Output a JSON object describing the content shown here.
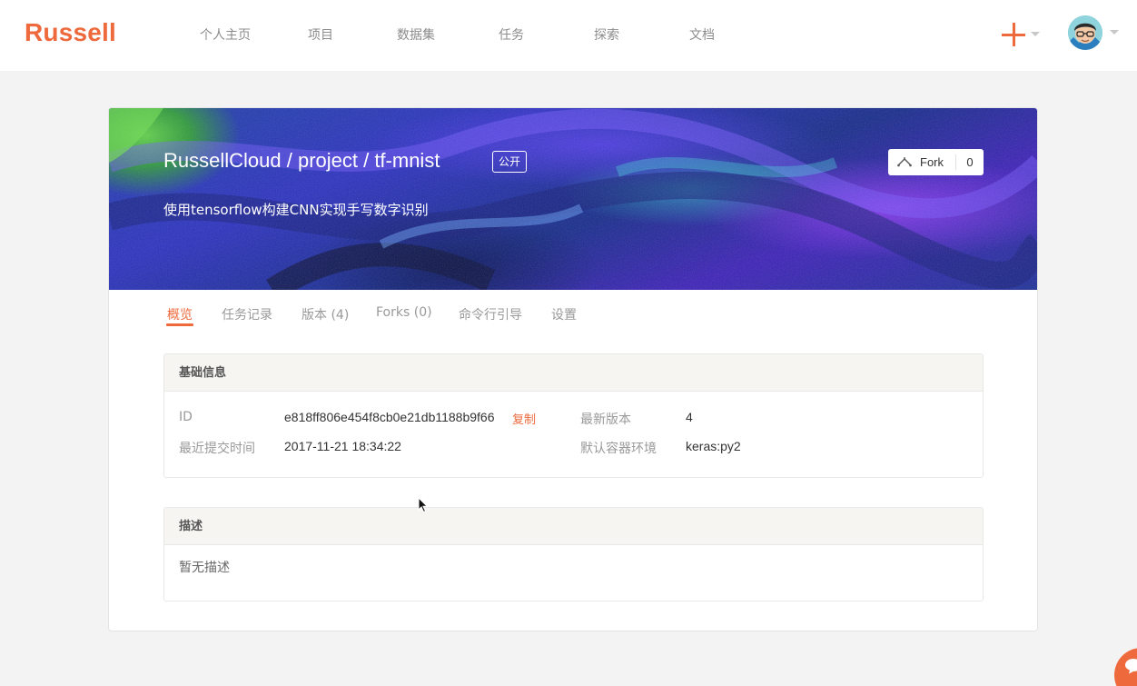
{
  "app": {
    "logo": "Russell"
  },
  "nav": {
    "items": [
      {
        "label": "个人主页"
      },
      {
        "label": "项目"
      },
      {
        "label": "数据集"
      },
      {
        "label": "任务"
      },
      {
        "label": "探索"
      },
      {
        "label": "文档"
      }
    ]
  },
  "project": {
    "title": "RussellCloud / project / tf-mnist",
    "visibility": "公开",
    "subtitle": "使用tensorflow构建CNN实现手写数字识别",
    "fork": {
      "label": "Fork",
      "count": "0"
    }
  },
  "tabs": [
    {
      "label": "概览",
      "active": true
    },
    {
      "label": "任务记录",
      "active": false
    },
    {
      "label": "版本 (4)",
      "active": false
    },
    {
      "label": "Forks (0)",
      "active": false
    },
    {
      "label": "命令行引导",
      "active": false
    },
    {
      "label": "设置",
      "active": false
    }
  ],
  "basic_info": {
    "title": "基础信息",
    "id_label": "ID",
    "id_value": "e818ff806e454f8cb0e21db1188b9f66",
    "copy_label": "复制",
    "latest_version_label": "最新版本",
    "latest_version_value": "4",
    "last_commit_label": "最近提交时间",
    "last_commit_value": "2017-11-21 18:34:22",
    "default_env_label": "默认容器环境",
    "default_env_value": "keras:py2"
  },
  "description": {
    "title": "描述",
    "text": "暂无描述"
  },
  "colors": {
    "brand": "#ee6a3d",
    "page_background": "#f3f3f3",
    "panel_header": "#f6f5f2"
  },
  "icons": {
    "create": "plus-icon",
    "dropdown": "caret-down-icon",
    "fork": "fork-icon",
    "chat": "chat-bubble-icon"
  }
}
